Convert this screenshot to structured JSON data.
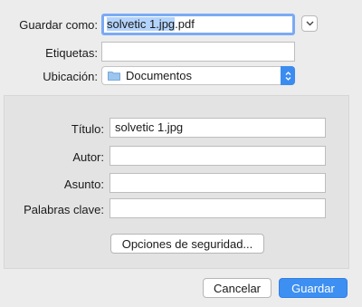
{
  "save_as": {
    "label": "Guardar como:",
    "filename_selected": "solvetic 1.jpg",
    "filename_ext": ".pdf"
  },
  "tags": {
    "label": "Etiquetas:",
    "value": ""
  },
  "location": {
    "label": "Ubicación:",
    "value": "Documentos",
    "icon": "folder-icon"
  },
  "metadata": {
    "title_label": "Título:",
    "title_value": "solvetic 1.jpg",
    "author_label": "Autor:",
    "author_value": "",
    "subject_label": "Asunto:",
    "subject_value": "",
    "keywords_label": "Palabras clave:",
    "keywords_value": "",
    "security_button": "Opciones de seguridad..."
  },
  "buttons": {
    "cancel": "Cancelar",
    "save": "Guardar"
  },
  "colors": {
    "accent": "#3d8ff2",
    "selection": "#b3d3fb",
    "focus_ring": "#7aaaf5"
  }
}
